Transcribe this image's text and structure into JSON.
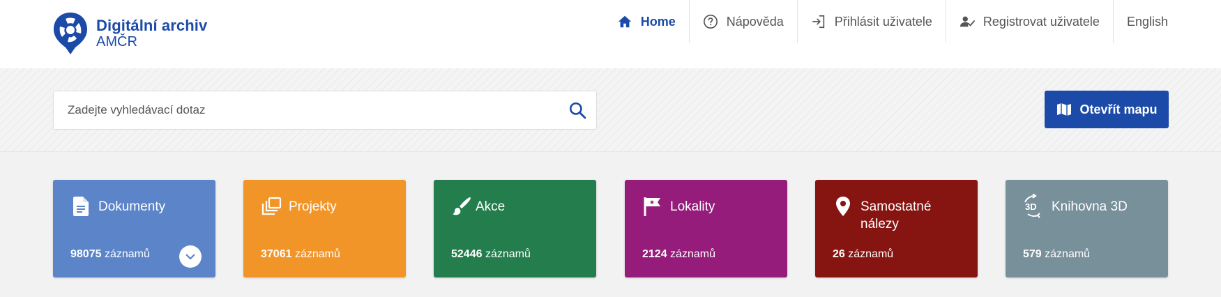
{
  "logo": {
    "title": "Digitální archiv",
    "subtitle": "AMČR"
  },
  "nav": {
    "items": [
      {
        "label": "Home",
        "icon": "home-icon",
        "active": true
      },
      {
        "label": "Nápověda",
        "icon": "help-circle-icon"
      },
      {
        "label": "Přihlásit uživatele",
        "icon": "login-icon"
      },
      {
        "label": "Registrovat uživatele",
        "icon": "user-check-icon"
      },
      {
        "label": "English"
      }
    ]
  },
  "search": {
    "placeholder": "Zadejte vyhledávací dotaz",
    "value": ""
  },
  "map_button": {
    "label": "Otevřít mapu",
    "icon": "map-icon"
  },
  "tiles": [
    {
      "title": "Dokumenty",
      "count": "98075",
      "unit": "záznamů",
      "color": "#5b84c9",
      "icon": "document-icon",
      "has_toggle": true
    },
    {
      "title": "Projekty",
      "count": "37061",
      "unit": "záznamů",
      "color": "#f29528",
      "icon": "layers-icon"
    },
    {
      "title": "Akce",
      "count": "52446",
      "unit": "záznamů",
      "color": "#247d4c",
      "icon": "brush-icon"
    },
    {
      "title": "Lokality",
      "count": "2124",
      "unit": "záznamů",
      "color": "#951c7a",
      "icon": "flag-icon"
    },
    {
      "title": "Samostatné nálezy",
      "count": "26",
      "unit": "záznamů",
      "color": "#861410",
      "icon": "map-pin-icon"
    },
    {
      "title": "Knihovna 3D",
      "count": "579",
      "unit": "záznamů",
      "color": "#78909a",
      "icon": "3d-rotate-icon"
    }
  ],
  "colors": {
    "brand": "#1b4aa8",
    "header_bg": "#ffffff",
    "page_bg": "#f2f2f2"
  }
}
